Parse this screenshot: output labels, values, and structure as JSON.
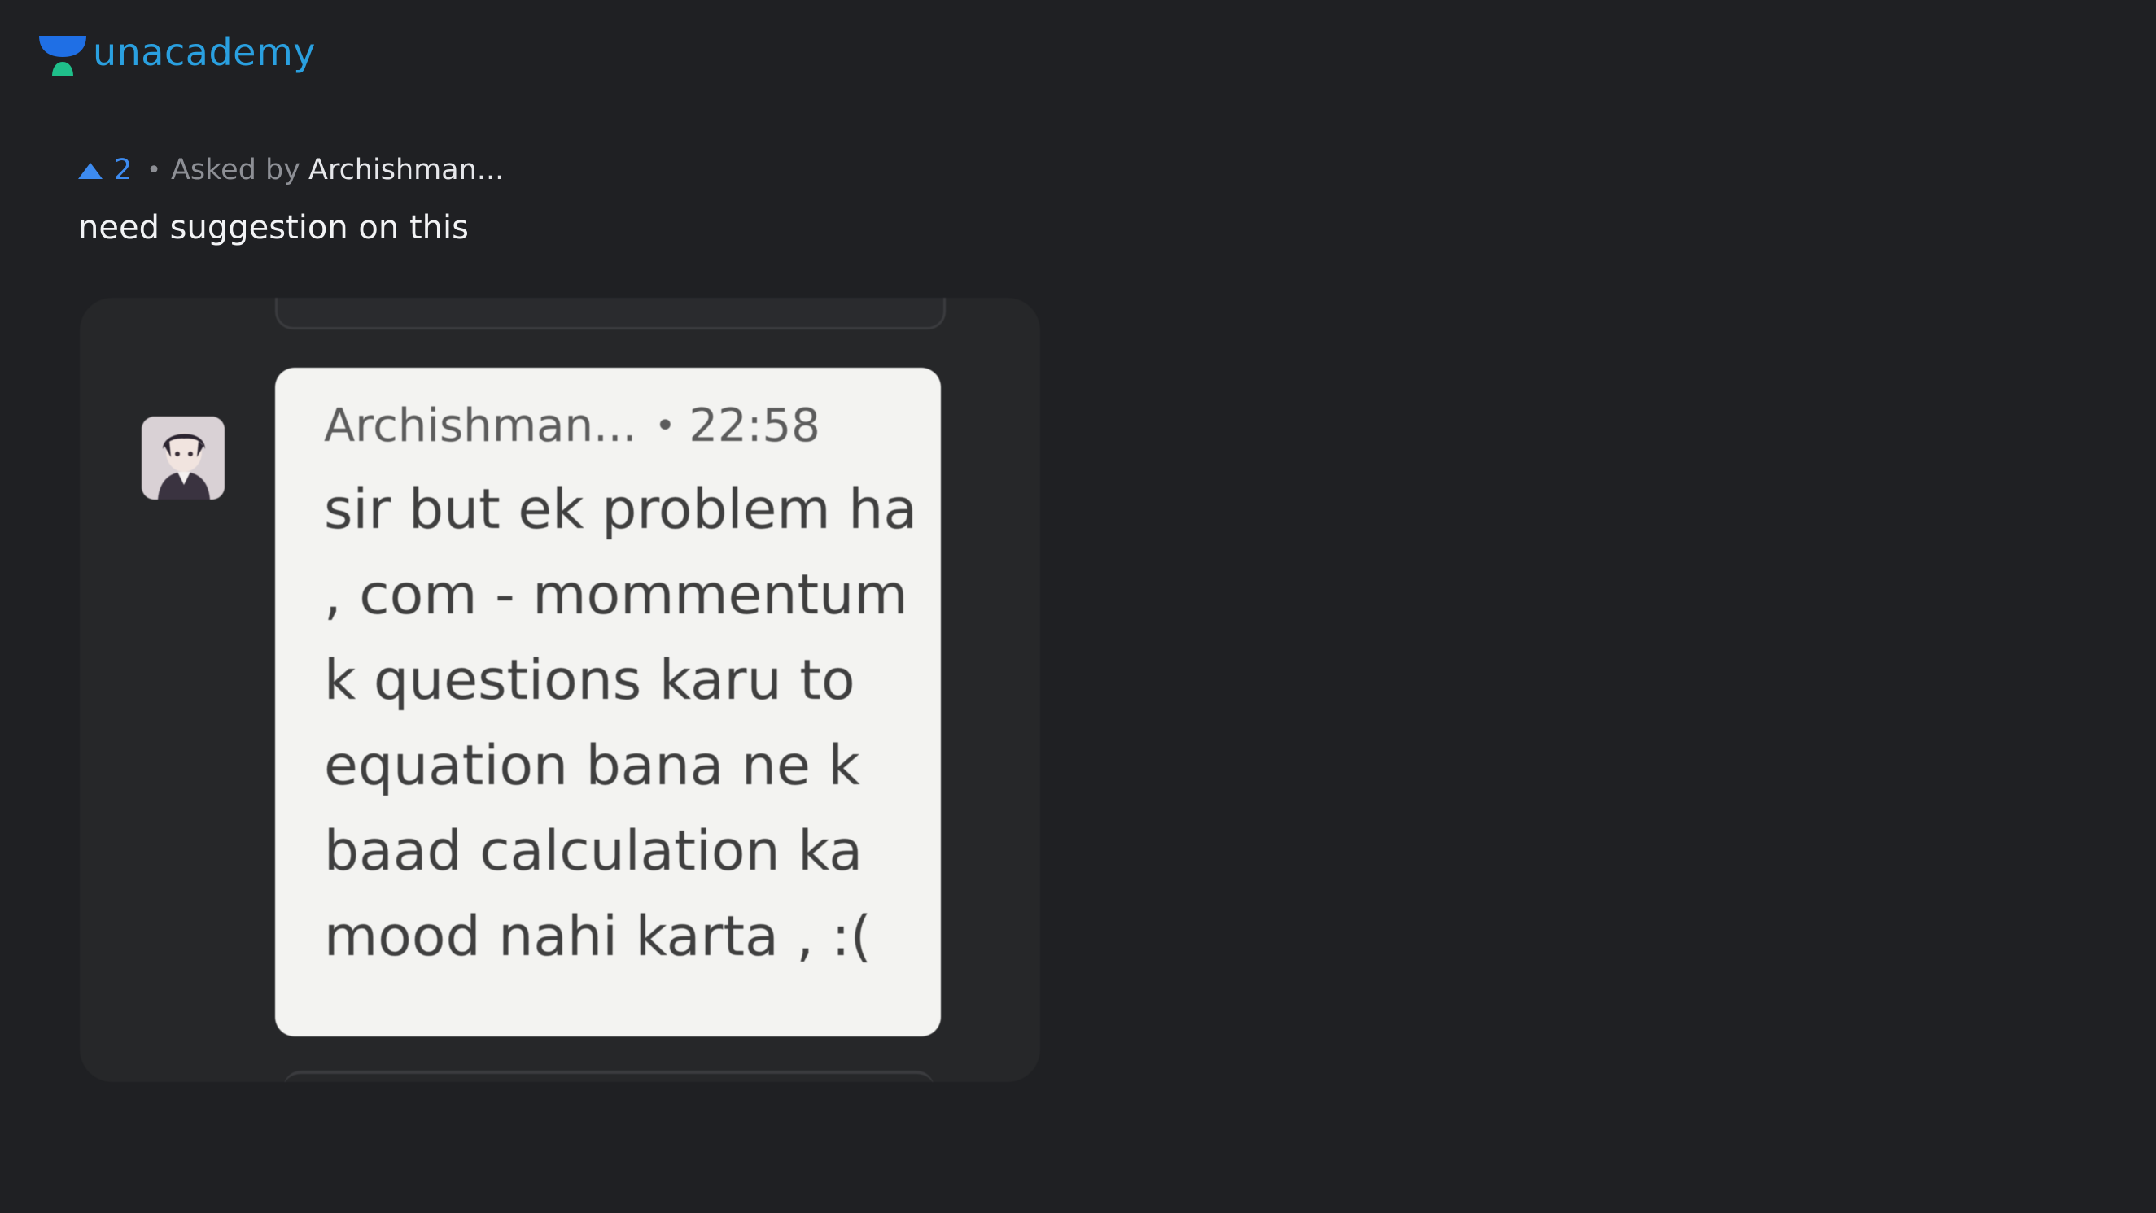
{
  "brand": {
    "name": "unacademy",
    "colors": {
      "mark_blue": "#1f6fe5",
      "mark_green": "#1fbf8a",
      "text": "#2aa0e0"
    }
  },
  "question": {
    "upvotes": "2",
    "separator": "•",
    "asked_by_label": "Asked by",
    "asker": "Archishman...",
    "text": "need suggestion on this"
  },
  "attachment": {
    "message": {
      "author": "Archishman...",
      "separator": "•",
      "time": "22:58",
      "lines": [
        "sir but ek problem ha",
        ", com - mommentum",
        "k questions karu to",
        "equation bana ne k",
        "baad calculation ka",
        "mood nahi karta , :("
      ]
    }
  },
  "icons": {
    "upvote": "triangle-up-icon",
    "logo": "unacademy-logo-icon",
    "avatar": "user-avatar"
  }
}
